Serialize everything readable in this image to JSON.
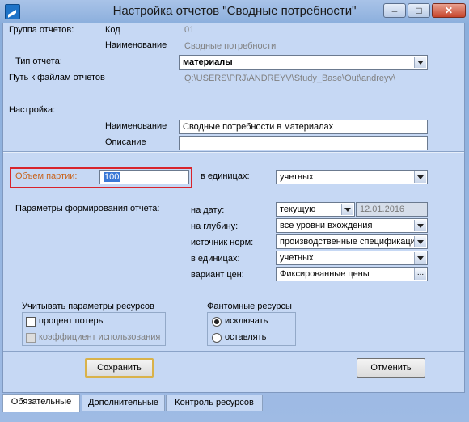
{
  "window": {
    "title": "Настройка отчетов \"Сводные потребности\""
  },
  "controls": {
    "minimize": "–",
    "maximize": "□",
    "close": "✕"
  },
  "group": {
    "label": "Группа отчетов:",
    "code_label": "Код",
    "code_value": "01",
    "name_label": "Наименование",
    "name_value": "Сводные потребности"
  },
  "report_type": {
    "label": "Тип отчета:",
    "value": "материалы"
  },
  "path": {
    "label": "Путь к файлам отчетов",
    "value": "Q:\\USERS\\PRJ\\ANDREYV\\Study_Base\\Out\\andreyv\\"
  },
  "setting": {
    "label": "Настройка:",
    "name_label": "Наименование",
    "name_value": "Сводные потребности в материалах",
    "desc_label": "Описание",
    "desc_value": ""
  },
  "batch": {
    "label": "Объем партии:",
    "value": "100",
    "units_label": "в единицах:",
    "units_value": "учетных"
  },
  "params": {
    "label": "Параметры формирования отчета:",
    "date_label": "на дату:",
    "date_value": "текущую",
    "date_field": "12.01.2016",
    "depth_label": "на глубину:",
    "depth_value": "все уровни вхождения",
    "source_label": "источник норм:",
    "source_value": "производственные спецификаци",
    "units_label": "в единицах:",
    "units_value": "учетных",
    "price_label": "вариант цен:",
    "price_value": "Фиксированные цены",
    "price_button": "..."
  },
  "resources": {
    "label": "Учитывать параметры ресурсов",
    "loss": "процент потерь",
    "usage": "коэффициент использования",
    "loss_checked": false,
    "usage_checked": false
  },
  "phantom": {
    "label": "Фантомные ресурсы",
    "exclude": "исключать",
    "keep": "оставлять",
    "selected": "исключать"
  },
  "buttons": {
    "save": "Сохранить",
    "cancel": "Отменить"
  },
  "tabs": [
    {
      "label": "Обязательные",
      "active": true
    },
    {
      "label": "Дополнительные",
      "active": false
    },
    {
      "label": "Контроль ресурсов",
      "active": false
    }
  ],
  "colors": {
    "highlight_label": "#c8641e",
    "red_box": "#d8242c",
    "selection": "#3a78d6"
  }
}
